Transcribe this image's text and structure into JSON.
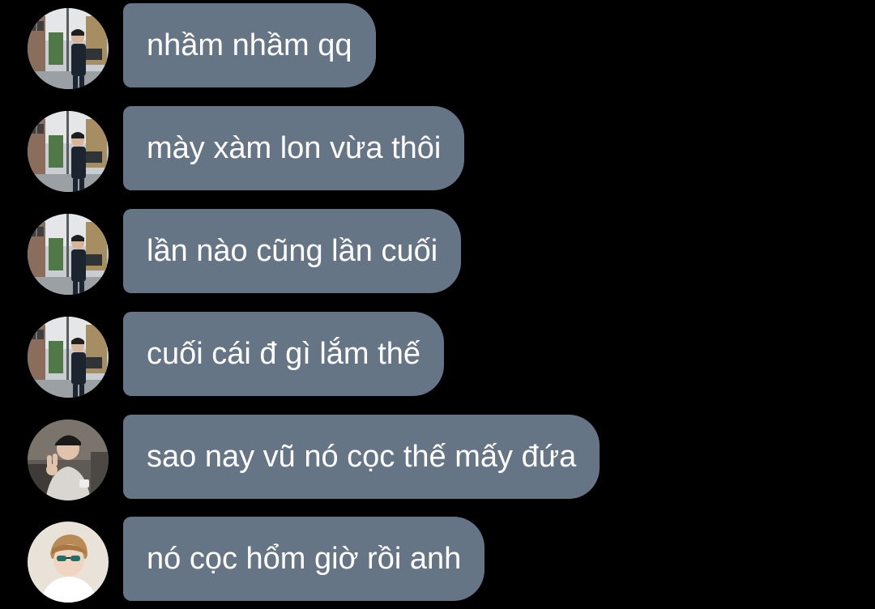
{
  "colors": {
    "background": "#000000",
    "bubble": "#667586",
    "text": "#ffffff"
  },
  "messages": [
    {
      "text": "nhầm nhầm qq",
      "avatar": "street-photo-avatar"
    },
    {
      "text": "mày xàm lon vừa thôi",
      "avatar": "street-photo-avatar"
    },
    {
      "text": "lần nào cũng lần cuối",
      "avatar": "street-photo-avatar"
    },
    {
      "text": "cuối cái đ gì lắm thế",
      "avatar": "street-photo-avatar"
    },
    {
      "text": "sao nay vũ nó cọc thế mấy đứa",
      "avatar": "peace-sign-avatar"
    },
    {
      "text": "nó cọc hổm giờ rồi anh",
      "avatar": "sunglasses-avatar"
    }
  ]
}
